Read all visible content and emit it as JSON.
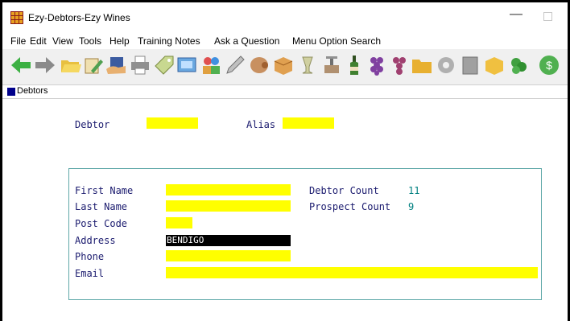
{
  "window": {
    "title": "Ezy-Debtors-Ezy Wines"
  },
  "menu": [
    "File",
    "Edit",
    "View",
    "Tools",
    "Help",
    "Training Notes",
    "Ask a Question",
    "Menu Option Search"
  ],
  "toolbar_icons": [
    "back-arrow-icon",
    "forward-arrow-icon",
    "folder-open-icon",
    "edit-document-icon",
    "hand-contact-icon",
    "printer-icon",
    "money-tag-icon",
    "screen-icon",
    "people-icon",
    "pencil-icon",
    "barrel-icon",
    "box-icon",
    "glass-icon",
    "wine-press-icon",
    "wine-bottle-icon",
    "grapes-icon",
    "folder-icon",
    "gear-icon",
    "book-icon",
    "cube-icon",
    "vine-icon",
    "dollar-icon"
  ],
  "tab": {
    "label": "Debtors"
  },
  "debtor": {
    "label": "Debtor",
    "value": ""
  },
  "alias": {
    "label": "Alias",
    "value": ""
  },
  "fields": {
    "first_name": {
      "label": "First Name",
      "value": ""
    },
    "last_name": {
      "label": "Last Name",
      "value": ""
    },
    "post_code": {
      "label": "Post Code",
      "value": ""
    },
    "address": {
      "label": "Address",
      "value": "BENDIGO"
    },
    "phone": {
      "label": "Phone",
      "value": ""
    },
    "email": {
      "label": "Email",
      "value": ""
    }
  },
  "counts": {
    "debtor": {
      "label": "Debtor Count",
      "value": "11"
    },
    "prospect": {
      "label": "Prospect Count",
      "value": "9"
    }
  },
  "colors": {
    "field": "#ffff00",
    "label": "#1a1a6e",
    "count": "#008080",
    "panel_border": "#5fa8a8"
  }
}
